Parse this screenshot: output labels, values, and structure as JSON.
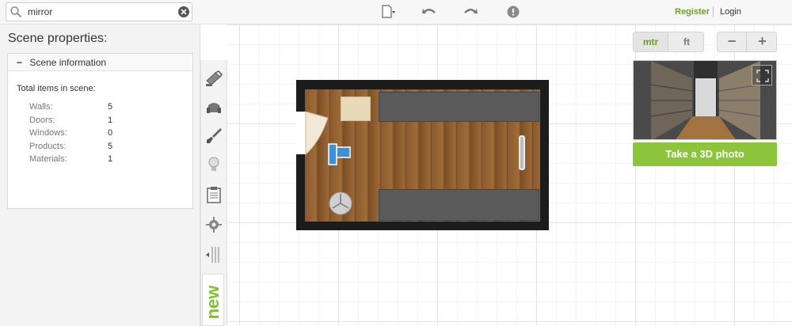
{
  "search": {
    "value": "mirror",
    "placeholder": ""
  },
  "auth": {
    "register_label": "Register",
    "login_label": "Login"
  },
  "toolbar": {
    "icons": [
      "new-file-icon",
      "undo-icon",
      "redo-icon",
      "help-icon"
    ]
  },
  "left_panel": {
    "title": "Scene properties:",
    "section_label": "Scene information",
    "total_label": "Total items in scene:",
    "stats": [
      {
        "label": "Walls:",
        "value": "5"
      },
      {
        "label": "Doors:",
        "value": "1"
      },
      {
        "label": "Windows:",
        "value": "0"
      },
      {
        "label": "Products:",
        "value": "5"
      },
      {
        "label": "Materials:",
        "value": "1"
      }
    ]
  },
  "side_tools": [
    "paint-roller-icon",
    "armchair-icon",
    "brush-icon",
    "lightbulb-icon",
    "clipboard-icon",
    "gear-icon",
    "collapse-icon"
  ],
  "new_badge": "new",
  "units": {
    "metric_label": "mtr",
    "imperial_label": "ft",
    "active": "mtr"
  },
  "zoom": {
    "out_label": "−",
    "in_label": "+"
  },
  "photo_button_label": "Take a 3D photo",
  "colors": {
    "accent": "#6aa11d",
    "photo_button": "#8cc43b",
    "new_badge": "#7cc22a"
  }
}
